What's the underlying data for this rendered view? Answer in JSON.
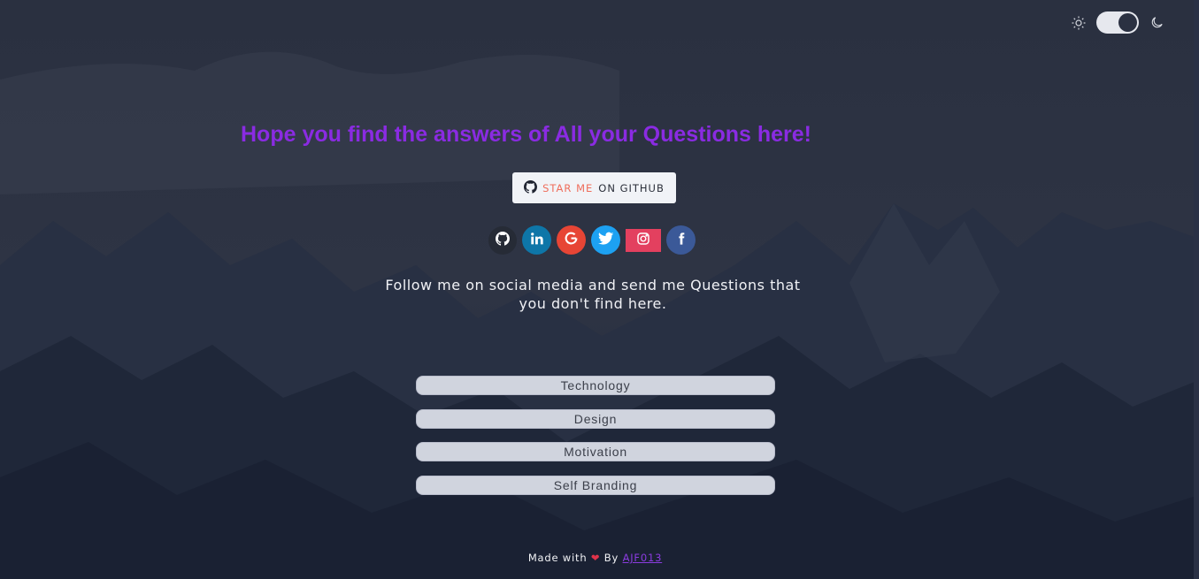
{
  "theme": {
    "sun_icon": "sun-icon",
    "moon_icon": "moon-icon",
    "mode": "dark"
  },
  "hero": {
    "headline": "Hope you find the answers of All your Questions here!",
    "headline_color": "#8a2be2"
  },
  "github_button": {
    "icon": "github-icon",
    "star_text": "STAR ME",
    "rest_text": "ON GITHUB"
  },
  "social": [
    {
      "name": "github",
      "icon": "github-icon",
      "color": "#262b36"
    },
    {
      "name": "linkedin",
      "icon": "linkedin-icon",
      "color": "#0e76a8"
    },
    {
      "name": "google",
      "icon": "google-icon",
      "color": "#e74535"
    },
    {
      "name": "twitter",
      "icon": "twitter-icon",
      "color": "#1da1f2"
    },
    {
      "name": "instagram",
      "icon": "instagram-icon",
      "color": "#e3405f"
    },
    {
      "name": "facebook",
      "icon": "facebook-icon",
      "color": "#3b5998"
    }
  ],
  "follow_text": "Follow me on social media and send me Questions that you don't find here.",
  "topics": [
    {
      "label": "Technology"
    },
    {
      "label": "Design"
    },
    {
      "label": "Motivation"
    },
    {
      "label": "Self Branding"
    }
  ],
  "footer": {
    "made_with": "Made with",
    "heart": "❤",
    "by": "By",
    "author": "AJF013"
  }
}
